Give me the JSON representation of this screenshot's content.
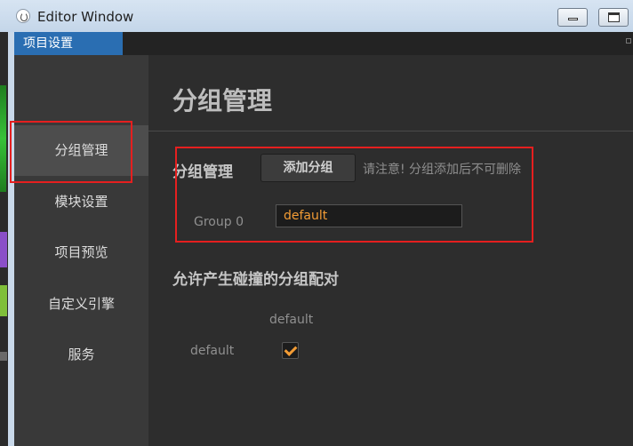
{
  "window": {
    "title": "Editor Window",
    "controls": [
      "minimize",
      "maximize"
    ]
  },
  "tabs": [
    {
      "label": "项目设置",
      "active": true
    }
  ],
  "sidebar": {
    "items": [
      {
        "label": "分组管理",
        "active": true
      },
      {
        "label": "模块设置",
        "active": false
      },
      {
        "label": "项目预览",
        "active": false
      },
      {
        "label": "自定义引擎",
        "active": false
      },
      {
        "label": "服务",
        "active": false
      }
    ]
  },
  "main": {
    "title": "分组管理",
    "group_section": {
      "title": "分组管理",
      "add_button_label": "添加分组",
      "hint": "请注意! 分组添加后不可删除",
      "groups": [
        {
          "label": "Group 0",
          "value": "default"
        }
      ]
    },
    "collision_section": {
      "title": "允许产生碰撞的分组配对",
      "columns": [
        "default"
      ],
      "rows": [
        {
          "label": "default",
          "checks": [
            true
          ]
        }
      ]
    }
  },
  "colors": {
    "accent_orange": "#f39c35",
    "tab_blue": "#2a6eb2",
    "annotation_red": "#e51f1f",
    "panel_bg": "#2d2d2d",
    "sidebar_bg": "#393939"
  }
}
